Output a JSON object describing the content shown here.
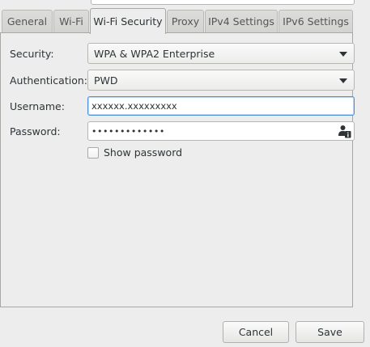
{
  "tabs": [
    {
      "label": "General",
      "active": false
    },
    {
      "label": "Wi-Fi",
      "active": false
    },
    {
      "label": "Wi-Fi Security",
      "active": true
    },
    {
      "label": "Proxy",
      "active": false
    },
    {
      "label": "IPv4 Settings",
      "active": false
    },
    {
      "label": "IPv6 Settings",
      "active": false
    }
  ],
  "form": {
    "security": {
      "label": "Security:",
      "value": "WPA & WPA2 Enterprise"
    },
    "authentication": {
      "label": "Authentication:",
      "value": "PWD"
    },
    "username": {
      "label": "Username:",
      "value": "xxxxxx.xxxxxxxxx"
    },
    "password": {
      "label": "Password:",
      "value": "•••••••••••••",
      "icon": "user-info-icon"
    },
    "show_password": {
      "label": "Show password",
      "checked": false
    }
  },
  "buttons": {
    "cancel": "Cancel",
    "save": "Save"
  },
  "colors": {
    "background": "#ededed",
    "focus": "#4a90d9",
    "border": "#b6b6b3"
  }
}
